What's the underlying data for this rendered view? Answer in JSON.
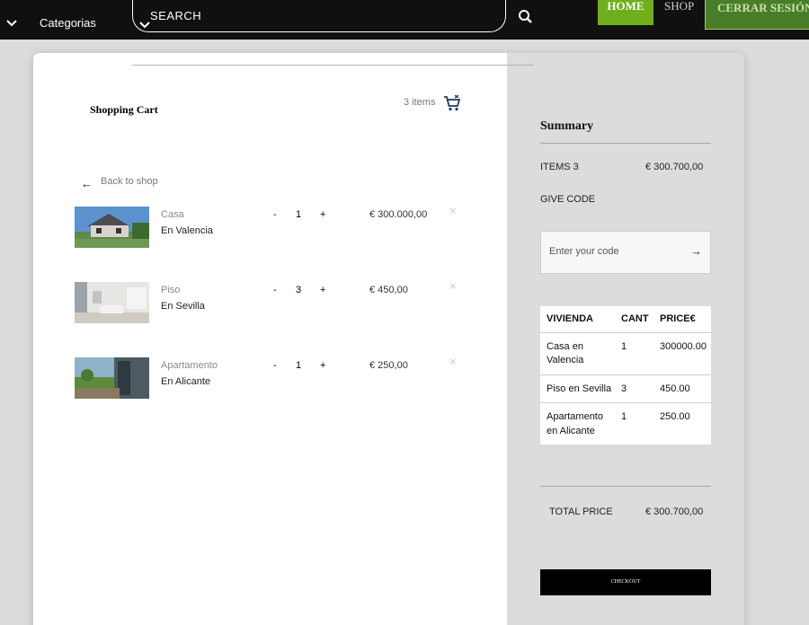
{
  "nav": {
    "categories_label": "Categorias",
    "search_placeholder": "SEARCH",
    "home_label": "HOME",
    "shop_label": "SHOP",
    "logout_label": "CERRAR SESIÓN",
    "icons": [
      "chevron-down-icon",
      "search-icon"
    ],
    "colors": {
      "bar": "#101010",
      "home": "#6fae1c",
      "logout": "#4a7d2a"
    }
  },
  "cart": {
    "title": "Shopping Cart",
    "items_count": "3 items",
    "back_label": "Back to shop",
    "back_arrow": "←",
    "remove_glyph": "×",
    "minus": "-",
    "plus": "+",
    "items": [
      {
        "name": "Casa",
        "location": "En Valencia",
        "qty": "1",
        "price": "€ 300.000,00"
      },
      {
        "name": "Piso",
        "location": "En Sevilla",
        "qty": "3",
        "price": "€ 450,00"
      },
      {
        "name": "Apartamento",
        "location": "En Alicante",
        "qty": "1",
        "price": "€ 250,00"
      }
    ]
  },
  "summary": {
    "title": "Summary",
    "items_label": "ITEMS 3",
    "items_total": "€ 300.700,00",
    "give_code_label": "GIVE CODE",
    "code_placeholder": "Enter your code",
    "code_arrow": "→",
    "table": {
      "headers": [
        "VIVIENDA",
        "CANT",
        "PRICE€"
      ],
      "rows": [
        [
          "Casa en Valencia",
          "1",
          "300000.00"
        ],
        [
          "Piso en Sevilla",
          "3",
          "450.00"
        ],
        [
          "Apartamento en Alicante",
          "1",
          "250.00"
        ]
      ]
    },
    "total_label": "TOTAL PRICE",
    "total_value": "€ 300.700,00",
    "checkout_label": "CHECKOUT"
  }
}
